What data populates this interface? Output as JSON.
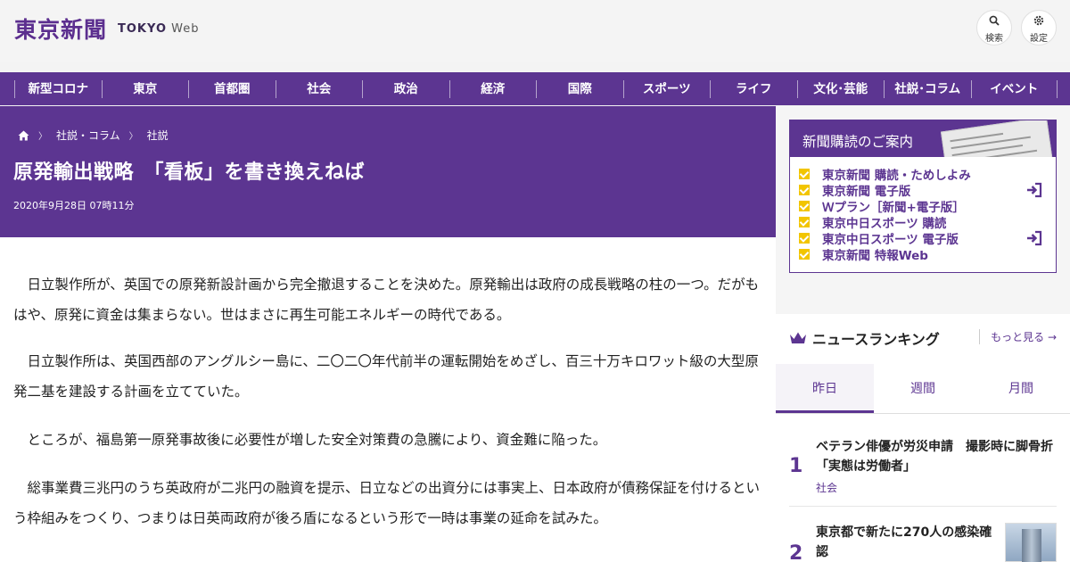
{
  "header": {
    "logo_text": "東京新聞",
    "logo_sub_bold": "TOKYO",
    "logo_sub_light": " Web",
    "search_label": "検索",
    "settings_label": "設定"
  },
  "nav": {
    "items": [
      "新型コロナ",
      "東京",
      "首都圏",
      "社会",
      "政治",
      "経済",
      "国際",
      "スポーツ",
      "ライフ",
      "文化･芸能",
      "社説･コラム",
      "イベント"
    ]
  },
  "breadcrumb": {
    "items": [
      "社説・コラム",
      "社説"
    ]
  },
  "article": {
    "title": "原発輸出戦略　「看板」を書き換えねば",
    "date": "2020年9月28日 07時11分",
    "paragraphs": [
      "日立製作所が、英国での原発新設計画から完全撤退することを決めた。原発輸出は政府の成長戦略の柱の一つ。だがもはや、原発に資金は集まらない。世はまさに再生可能エネルギーの時代である。",
      "日立製作所は、英国西部のアングルシー島に、二〇二〇年代前半の運転開始をめざし、百三十万キロワット級の大型原発二基を建設する計画を立てていた。",
      "ところが、福島第一原発事故後に必要性が増した安全対策費の急騰により、資金難に陥った。",
      "総事業費三兆円のうち英政府が二兆円の融資を提示、日立などの出資分には事実上、日本政府が債務保証を付けるという枠組みをつくり、つまりは日英両政府が後ろ盾になるという形で一時は事業の延命を試みた。"
    ]
  },
  "subscription": {
    "heading": "新聞購読のご案内",
    "items": [
      "東京新聞 購読・ためしよみ",
      "東京新聞 電子版",
      "Ｗプラン［新聞+電子版］",
      "東京中日スポーツ 購読",
      "東京中日スポーツ 電子版",
      "東京新聞 特報Web"
    ]
  },
  "ranking": {
    "title": "ニュースランキング",
    "more": "もっと見る",
    "tabs": [
      "昨日",
      "週間",
      "月間"
    ],
    "items": [
      {
        "rank": "1",
        "title": "ベテラン俳優が労災申請　撮影時に脚骨折「実態は労働者」",
        "category": "社会"
      },
      {
        "rank": "2",
        "title": "東京都で新たに270人の感染確認",
        "category": ""
      }
    ]
  },
  "colors": {
    "brand_purple": "#5c3591",
    "check_yellow": "#f2c500"
  }
}
